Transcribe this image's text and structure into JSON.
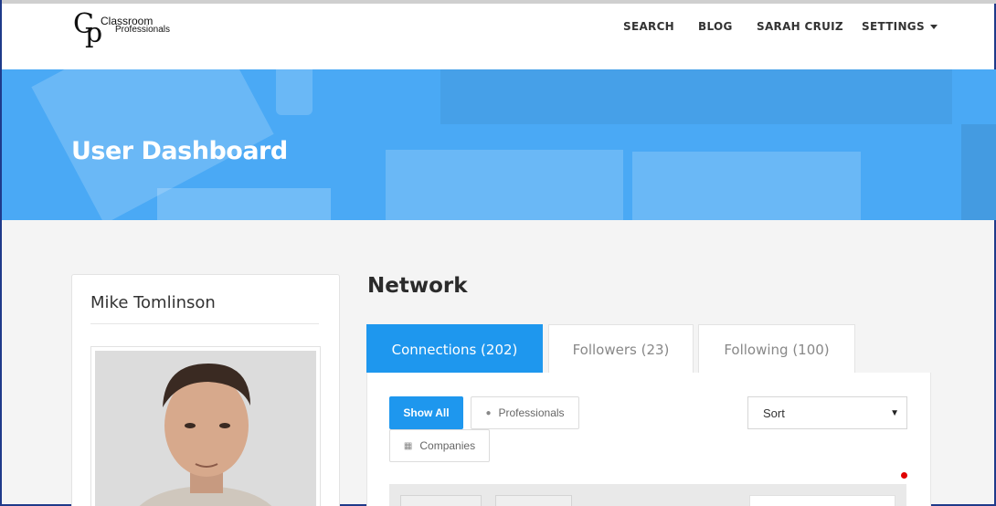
{
  "brand": {
    "mark_c": "C",
    "mark_p": "p",
    "line1": "Classroom",
    "line2": "Professionals"
  },
  "nav": {
    "search": "SEARCH",
    "blog": "BLOG",
    "user": "SARAH CRUIZ",
    "settings": "SETTINGS"
  },
  "banner": {
    "title": "User Dashboard"
  },
  "profile": {
    "name": "Mike Tomlinson"
  },
  "network": {
    "title": "Network",
    "tabs": [
      {
        "label": "Connections (202)",
        "active": true
      },
      {
        "label": "Followers (23)",
        "active": false
      },
      {
        "label": "Following (100)",
        "active": false
      }
    ],
    "filters": {
      "show_all": "Show All",
      "professionals": "Professionals",
      "companies": "Companies"
    },
    "sort": {
      "selected": "Sort"
    }
  },
  "colors": {
    "accent": "#1e97ee",
    "banner": "#4aa9f5",
    "notification": "#e00000"
  }
}
